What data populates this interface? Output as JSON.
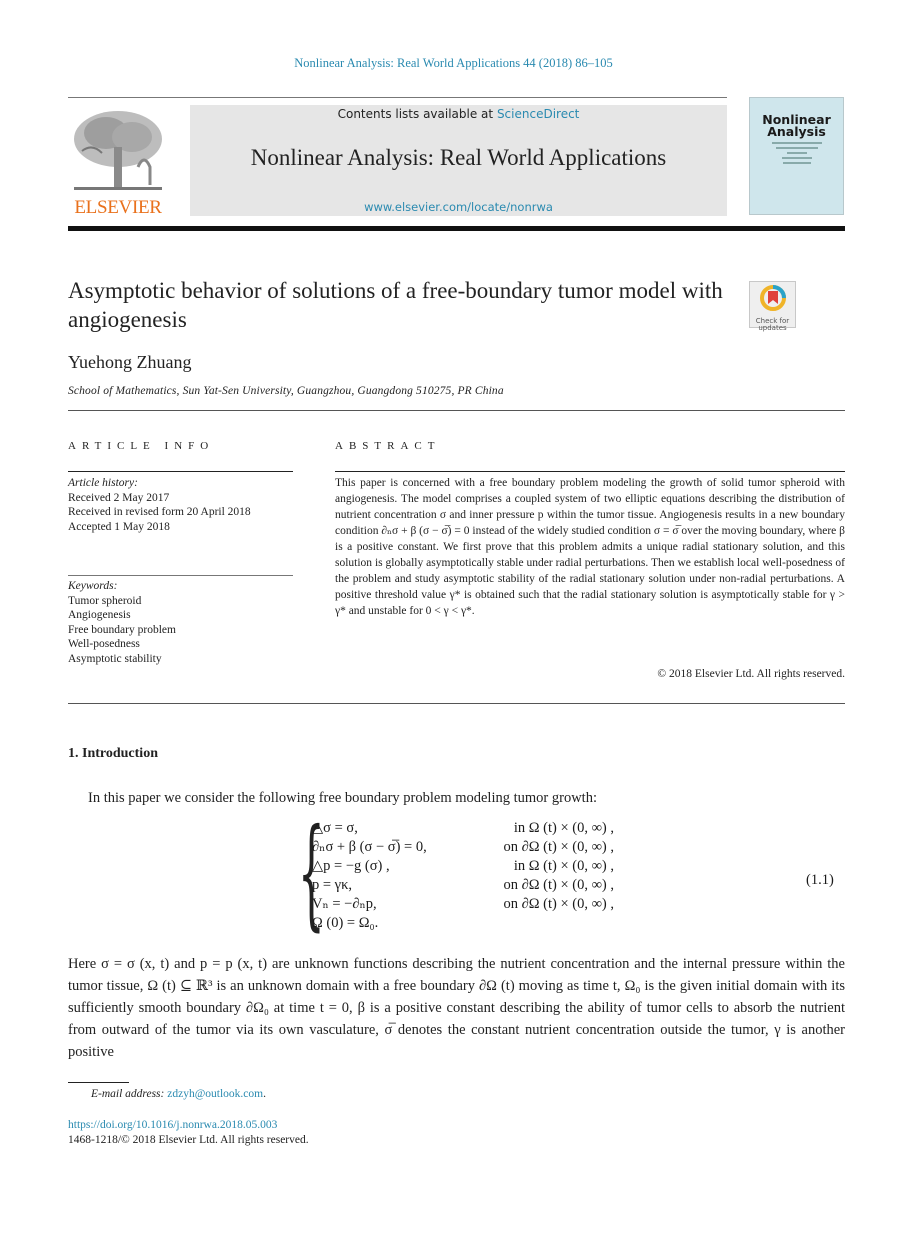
{
  "header": {
    "journal_reference": "Nonlinear Analysis: Real World Applications 44 (2018) 86–105",
    "contents_prefix": "Contents lists available at ",
    "contents_link": "ScienceDirect",
    "journal_title": "Nonlinear Analysis: Real World Applications",
    "journal_url": "www.elsevier.com/locate/nonrwa",
    "publisher_logo_text": "ELSEVIER",
    "cover_title_line1": "Nonlinear",
    "cover_title_line2": "Analysis",
    "check_updates_label_1": "Check for",
    "check_updates_label_2": "updates"
  },
  "article": {
    "title": "Asymptotic behavior of solutions of a free-boundary tumor model with angiogenesis",
    "author": "Yuehong Zhuang",
    "affiliation": "School of Mathematics, Sun Yat-Sen University, Guangzhou, Guangdong 510275, PR China"
  },
  "article_info": {
    "heading": "ARTICLE INFO",
    "history_label": "Article history:",
    "history": [
      "Received 2 May 2017",
      "Received in revised form 20 April 2018",
      "Accepted 1 May 2018"
    ],
    "keywords_label": "Keywords:",
    "keywords": [
      "Tumor spheroid",
      "Angiogenesis",
      "Free boundary problem",
      "Well-posedness",
      "Asymptotic stability"
    ]
  },
  "abstract": {
    "heading": "ABSTRACT",
    "text": "This paper is concerned with a free boundary problem modeling the growth of solid tumor spheroid with angiogenesis. The model comprises a coupled system of two elliptic equations describing the distribution of nutrient concentration σ and inner pressure p within the tumor tissue. Angiogenesis results in a new boundary condition ∂ₙσ + β (σ − σ̅) = 0 instead of the widely studied condition σ = σ̅ over the moving boundary, where β is a positive constant. We first prove that this problem admits a unique radial stationary solution, and this solution is globally asymptotically stable under radial perturbations. Then we establish local well-posedness of the problem and study asymptotic stability of the radial stationary solution under non-radial perturbations. A positive threshold value γ* is obtained such that the radial stationary solution is asymptotically stable for γ > γ* and unstable for 0 < γ < γ*.",
    "copyright": "© 2018 Elsevier Ltd. All rights reserved."
  },
  "introduction": {
    "section_title": "1.  Introduction",
    "lead_sentence": "In this paper we consider the following free boundary problem modeling tumor growth:",
    "equation_system": [
      {
        "lhs": "△σ = σ,",
        "rhs": "in Ω (t) × (0, ∞) ,"
      },
      {
        "lhs": "∂ₙσ + β (σ − σ̅) = 0,",
        "rhs": "on ∂Ω (t) × (0, ∞) ,"
      },
      {
        "lhs": "△p = −g (σ) ,",
        "rhs": "in Ω (t) × (0, ∞) ,"
      },
      {
        "lhs": "p = γκ,",
        "rhs": "on ∂Ω (t) × (0, ∞) ,"
      },
      {
        "lhs": "Vₙ = −∂ₙp,",
        "rhs": "on ∂Ω (t) × (0, ∞) ,"
      },
      {
        "lhs": "Ω (0) = Ω₀.",
        "rhs": ""
      }
    ],
    "equation_number": "(1.1)",
    "paragraph": "Here σ = σ (x, t) and p = p (x, t) are unknown functions describing the nutrient concentration and the internal pressure within the tumor tissue, Ω (t) ⊆ ℝ³ is an unknown domain with a free boundary ∂Ω (t) moving as time t, Ω₀ is the given initial domain with its sufficiently smooth boundary ∂Ω₀ at time t = 0, β is a positive constant describing the ability of tumor cells to absorb the nutrient from outward of the tumor via its own vasculature, σ̅ denotes the constant nutrient concentration outside the tumor, γ is another positive"
  },
  "footer": {
    "email_label": "E-mail address: ",
    "email": "zdzyh@outlook.com",
    "email_suffix": ".",
    "doi": "https://doi.org/10.1016/j.nonrwa.2018.05.003",
    "issn_line": "1468-1218/© 2018 Elsevier Ltd. All rights reserved."
  },
  "colors": {
    "link": "#2a8ab0",
    "elsevier_orange": "#e9711c",
    "header_box": "#e6e6e6",
    "cover": "#cfe6ec"
  }
}
